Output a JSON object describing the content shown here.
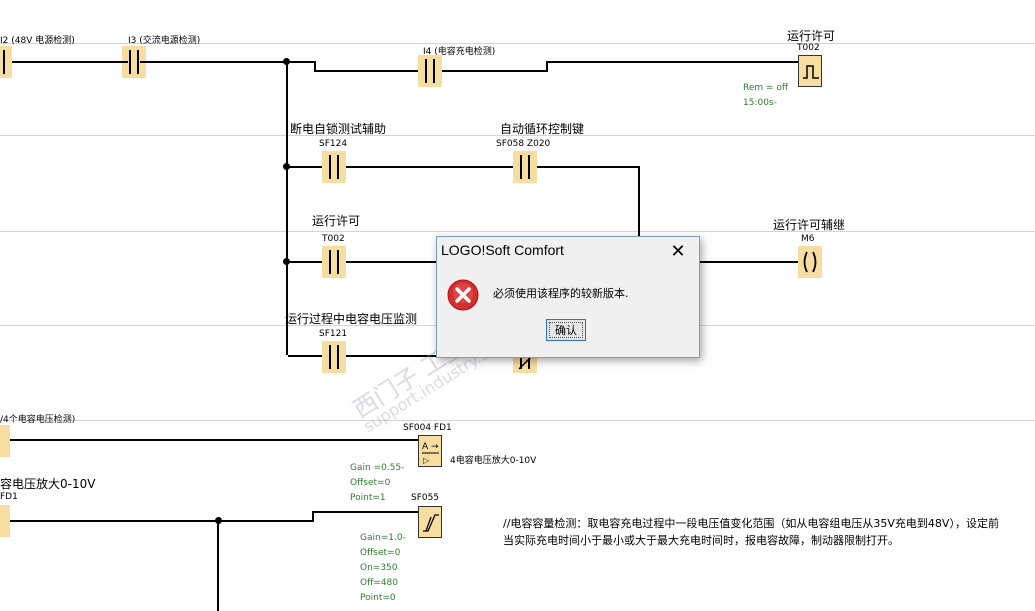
{
  "diagram": {
    "top_labels": {
      "i2": "I2 (48V 电源检测)",
      "i3": "I3 (交流电源检测)",
      "i4": "I4 (电容充电检测)",
      "t002_title": "运行许可",
      "t002_block": "T002",
      "t002_rem": "Rem = off",
      "t002_time": "15:00s-"
    },
    "rung2": {
      "sf124_title": "断电自锁测试辅助",
      "sf124": "SF124",
      "sf058_title": "自动循环控制键",
      "sf058": "SF058 Z020"
    },
    "rung3": {
      "t002_title": "运行许可",
      "t002": "T002",
      "m6_title": "运行许可辅继",
      "m6": "M6"
    },
    "rung4": {
      "sf121_title": "运行过程中电容电压监测",
      "sf121": "SF121"
    },
    "analog": {
      "left_label": "/4个电容电压检测)",
      "sf004": "SF004 FD1",
      "sf004_desc": "4电容电压放大0-10V",
      "sf004_params": [
        "Gain =0.55-",
        "Offset=0",
        "Point=1"
      ],
      "left2_label": "容电压放大0-10V",
      "fd1": "FD1",
      "sf055": "SF055",
      "sf055_params": [
        "Gain=1.0-",
        "Offset=0",
        "On=350",
        "Off=480",
        "Point=0"
      ]
    },
    "comment": {
      "line1": "//电容容量检测：取电容充电过程中一段电压值变化范围（如从电容组电压从35V充电到48V），设定前",
      "line2": "当实际充电时间小于最小或大于最大充电时间时，报电容故障，制动器限制打开。"
    },
    "watermark": {
      "line1": "西门子 工业 技术论坛",
      "line2": "support.industry.siemens.com/cs"
    }
  },
  "dialog": {
    "title": "LOGO!Soft Comfort",
    "message": "必须使用该程序的较新版本.",
    "ok_label": "确认",
    "close_glyph": "✕"
  }
}
